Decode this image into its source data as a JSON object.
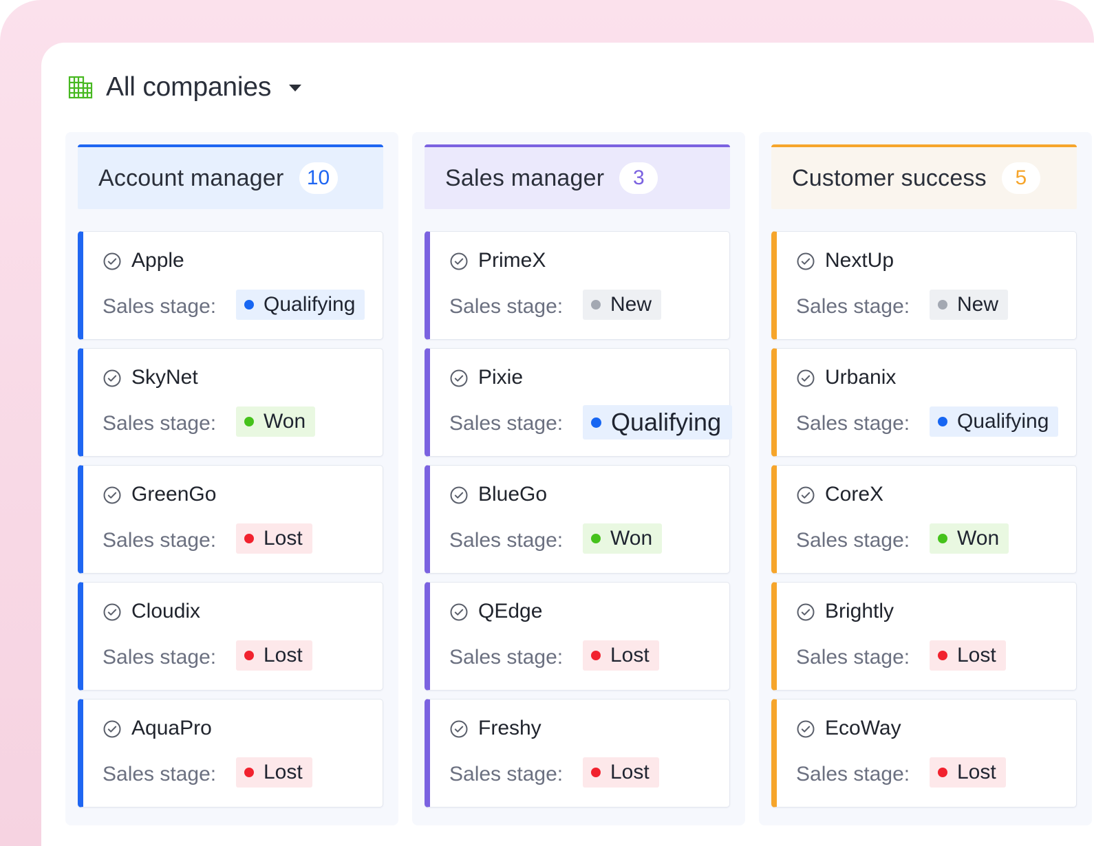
{
  "header": {
    "title": "All companies",
    "icon": "building-grid-icon",
    "icon_color": "#47b821"
  },
  "sales_stage_label": "Sales stage:",
  "columns": [
    {
      "title": "Account manager",
      "count": "10",
      "accent": "#1f66f2",
      "header_bg": "#e7f0fe",
      "cards": [
        {
          "name": "Apple",
          "stage": "Qualifying"
        },
        {
          "name": "SkyNet",
          "stage": "Won"
        },
        {
          "name": "GreenGo",
          "stage": "Lost"
        },
        {
          "name": "Cloudix",
          "stage": "Lost"
        },
        {
          "name": "AquaPro",
          "stage": "Lost"
        }
      ]
    },
    {
      "title": "Sales manager",
      "count": "3",
      "accent": "#7b62e0",
      "header_bg": "#ebe9fc",
      "cards": [
        {
          "name": "PrimeX",
          "stage": "New"
        },
        {
          "name": "Pixie",
          "stage": "Qualifying"
        },
        {
          "name": "BlueGo",
          "stage": "Won"
        },
        {
          "name": "QEdge",
          "stage": "Lost"
        },
        {
          "name": "Freshy",
          "stage": "Lost"
        }
      ]
    },
    {
      "title": "Customer success",
      "count": "5",
      "accent": "#f6a52b",
      "header_bg": "#faf5ee",
      "cards": [
        {
          "name": "NextUp",
          "stage": "New"
        },
        {
          "name": "Urbanix",
          "stage": "Qualifying"
        },
        {
          "name": "CoreX",
          "stage": "Won"
        },
        {
          "name": "Brightly",
          "stage": "Lost"
        },
        {
          "name": "EcoWay",
          "stage": "Lost"
        }
      ]
    }
  ]
}
